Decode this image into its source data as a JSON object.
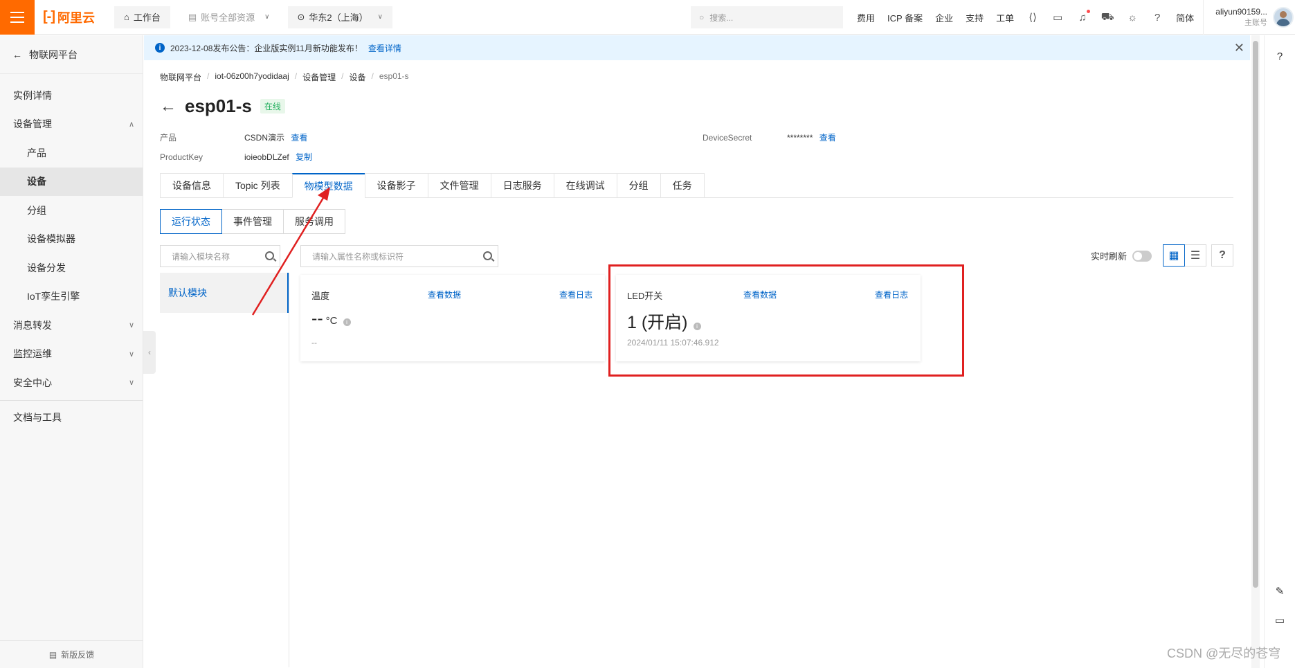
{
  "topbar": {
    "brand": "阿里云",
    "workbench": "工作台",
    "resource_scope": "账号全部资源",
    "region": "华东2（上海）",
    "search_placeholder": "搜索...",
    "links": [
      "费用",
      "ICP 备案",
      "企业",
      "支持",
      "工单"
    ],
    "lang": "简体",
    "username": "aliyun90159...",
    "account_type": "主账号"
  },
  "sidebar": {
    "back_label": "物联网平台",
    "items": [
      {
        "label": "实例详情",
        "level": 1
      },
      {
        "label": "设备管理",
        "level": 1,
        "expanded": true
      },
      {
        "label": "产品",
        "level": 2
      },
      {
        "label": "设备",
        "level": 2,
        "active": true
      },
      {
        "label": "分组",
        "level": 2
      },
      {
        "label": "设备模拟器",
        "level": 2
      },
      {
        "label": "设备分发",
        "level": 2
      },
      {
        "label": "IoT孪生引擎",
        "level": 2
      },
      {
        "label": "消息转发",
        "level": 1,
        "collapsed": true
      },
      {
        "label": "监控运维",
        "level": 1,
        "collapsed": true
      },
      {
        "label": "安全中心",
        "level": 1,
        "collapsed": true
      }
    ],
    "tools_label": "文档与工具",
    "feedback_label": "新版反馈"
  },
  "notice": {
    "text": "2023-12-08发布公告：企业版实例11月新功能发布！",
    "link": "查看详情"
  },
  "breadcrumb": [
    "物联网平台",
    "iot-06z00h7yodidaaj",
    "设备管理",
    "设备",
    "esp01-s"
  ],
  "device": {
    "name": "esp01-s",
    "status": "在线",
    "product_label": "产品",
    "product_value": "CSDN演示",
    "product_link": "查看",
    "productkey_label": "ProductKey",
    "productkey_value": "ioieobDLZef",
    "productkey_link": "复制",
    "secret_label": "DeviceSecret",
    "secret_value": "********",
    "secret_link": "查看"
  },
  "tabs": [
    "设备信息",
    "Topic 列表",
    "物模型数据",
    "设备影子",
    "文件管理",
    "日志服务",
    "在线调试",
    "分组",
    "任务"
  ],
  "active_tab": "物模型数据",
  "subtabs": [
    "运行状态",
    "事件管理",
    "服务调用"
  ],
  "module_search_placeholder": "请输入模块名称",
  "prop_search_placeholder": "请输入属性名称或标识符",
  "modules": [
    "默认模块"
  ],
  "realtime_label": "实时刷新",
  "realtime_on": false,
  "cards": [
    {
      "name": "温度",
      "link_data": "查看数据",
      "link_log": "查看日志",
      "value": "--",
      "unit": "°C",
      "time": "--"
    },
    {
      "name": "LED开关",
      "link_data": "查看数据",
      "link_log": "查看日志",
      "value": "1 (开启)",
      "unit": "",
      "time": "2024/01/11 15:07:46.912"
    }
  ],
  "colors": {
    "brand": "#ff6a00",
    "link": "#0064c8",
    "online": "#1fae5b",
    "highlight": "#e02020"
  },
  "watermark": "CSDN @无尽的苍穹"
}
